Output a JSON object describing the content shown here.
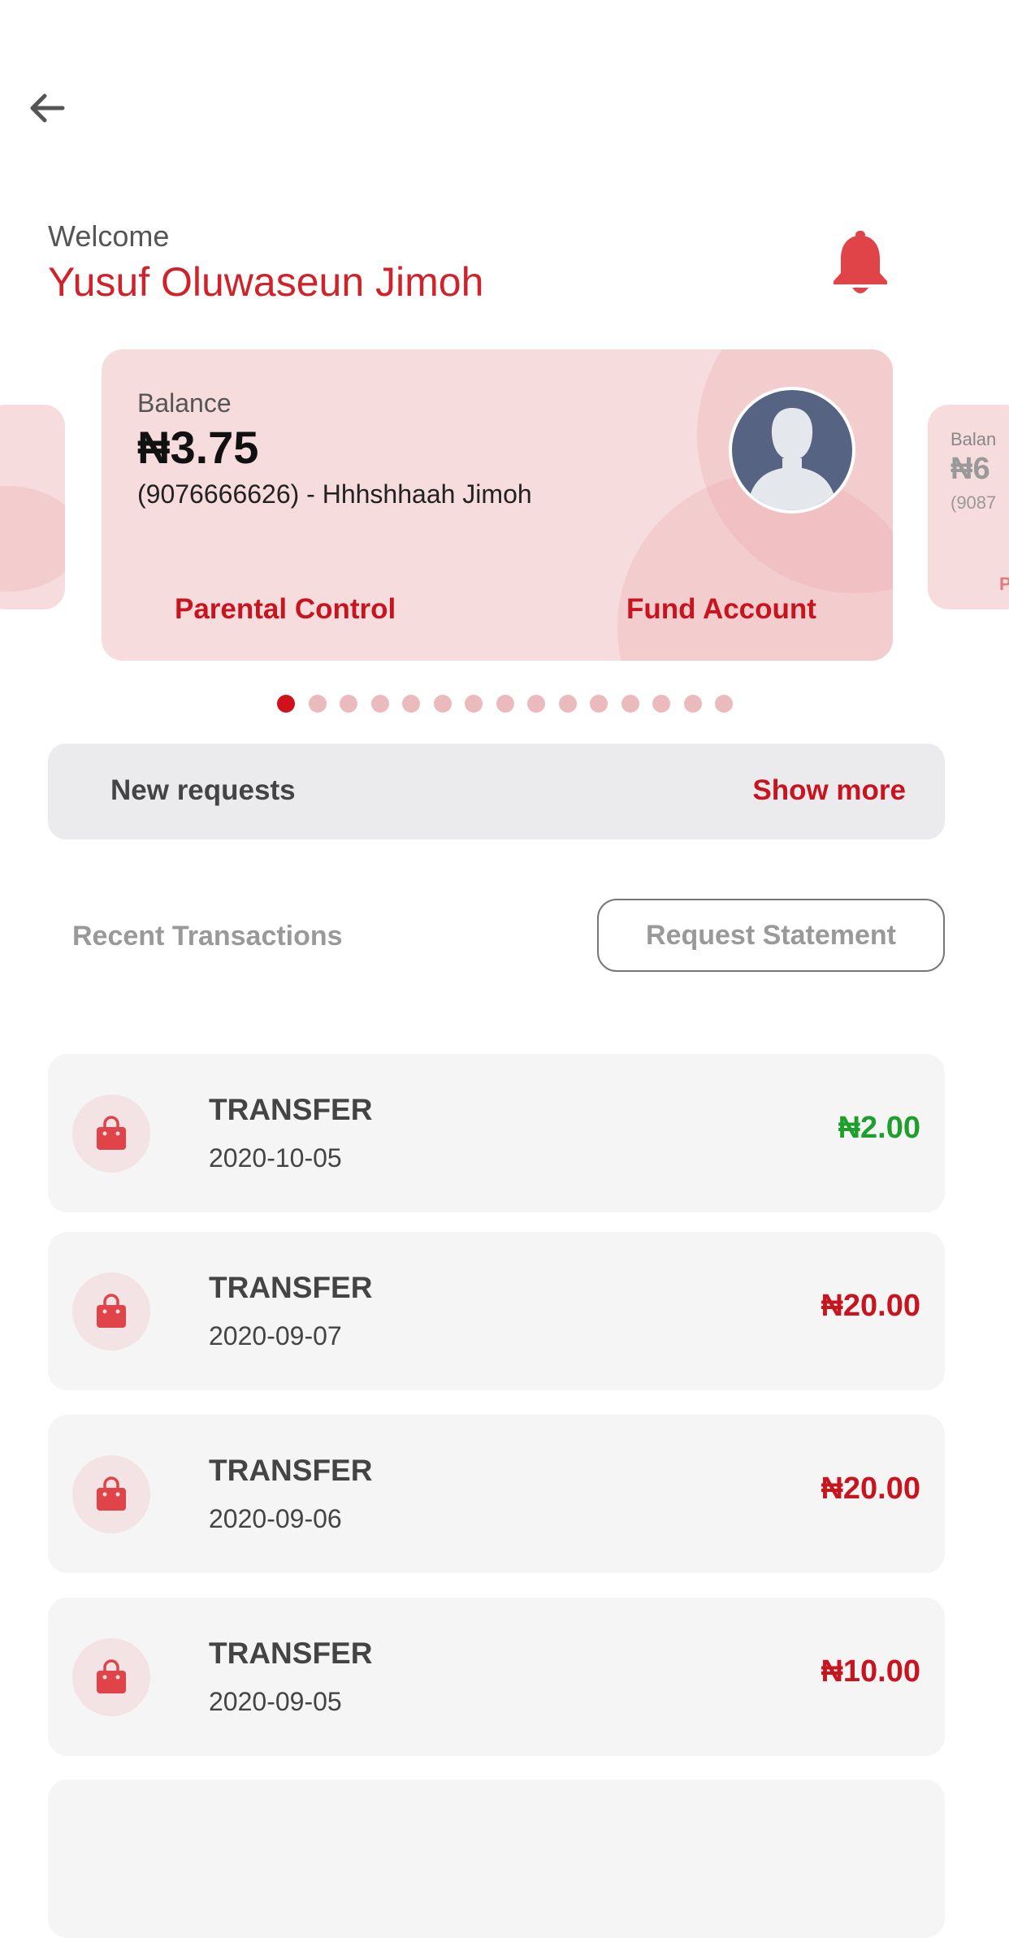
{
  "header": {
    "welcome": "Welcome",
    "user_name": "Yusuf Oluwaseun Jimoh"
  },
  "carousel": {
    "main_card": {
      "balance_label": "Balance",
      "balance": "₦3.75",
      "account": "(9076666626) - Hhhshhaah Jimoh",
      "parental_control": "Parental Control",
      "fund_account": "Fund Account"
    },
    "right_peek": {
      "balance_label": "Balan",
      "balance": "₦6",
      "account": "(9087",
      "action": "Pa"
    },
    "page_count": 15,
    "active_page": 1
  },
  "requests": {
    "label": "New requests",
    "show_more": "Show more"
  },
  "transactions_header": {
    "title": "Recent Transactions",
    "request_statement": "Request Statement"
  },
  "transactions": [
    {
      "title": "TRANSFER",
      "date": "2020-10-05",
      "amount": "₦2.00",
      "kind": "credit"
    },
    {
      "title": "TRANSFER",
      "date": "2020-09-07",
      "amount": "₦20.00",
      "kind": "debit"
    },
    {
      "title": "TRANSFER",
      "date": "2020-09-06",
      "amount": "₦20.00",
      "kind": "debit"
    },
    {
      "title": "TRANSFER",
      "date": "2020-09-05",
      "amount": "₦10.00",
      "kind": "debit"
    }
  ],
  "colors": {
    "brand_red": "#c8141e",
    "credit_green": "#1e9e2c",
    "card_pink": "#f7dcdd"
  },
  "icons": {
    "back": "arrow-left-icon",
    "notifications": "bell-icon",
    "avatar": "user-silhouette-icon",
    "transaction": "shopping-bag-icon"
  }
}
